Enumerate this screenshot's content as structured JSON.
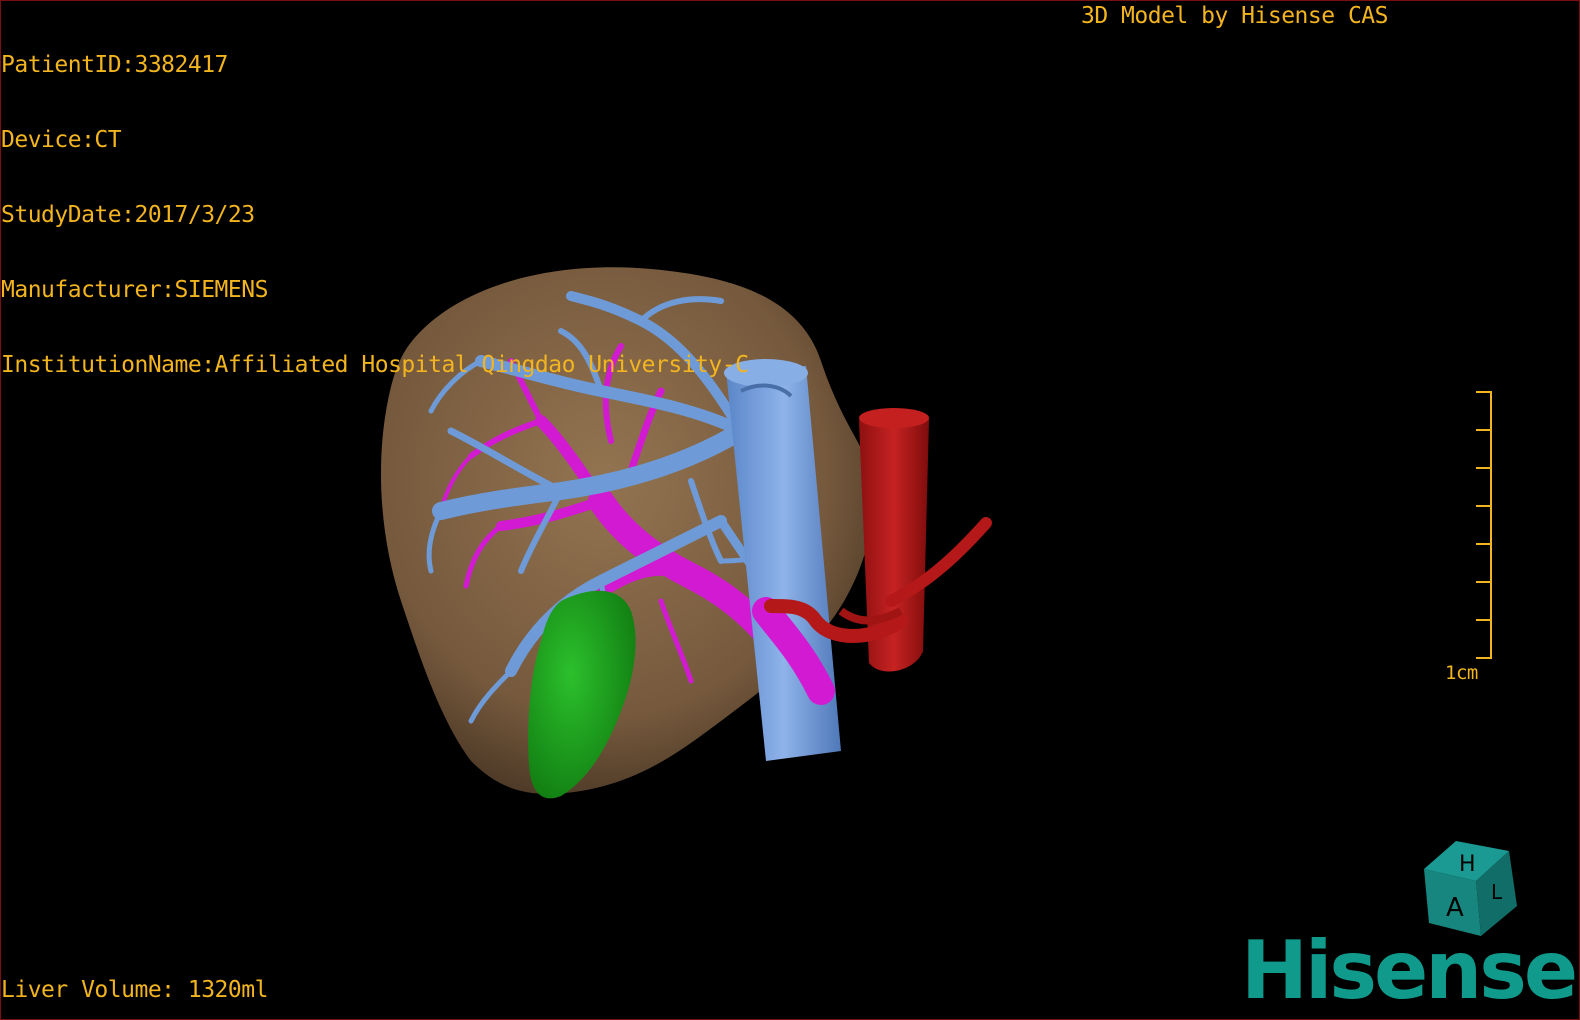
{
  "overlay": {
    "patient_id": "PatientID:3382417",
    "device": "Device:CT",
    "study_date": "StudyDate:2017/3/23",
    "manufacturer": "Manufacturer:SIEMENS",
    "institution": "InstitutionName:Affiliated Hospital Qingdao University-C",
    "model_credit": "3D Model by Hisense CAS",
    "liver_volume": "Liver Volume: 1320ml"
  },
  "scale_bar": {
    "label": "1cm"
  },
  "orientation_cube": {
    "face_top": "H",
    "face_front": "A",
    "face_side": "L"
  },
  "brand": {
    "logo_text": "Hisense"
  },
  "colors": {
    "overlay_text": "#f2b41f",
    "liver": "#8a6a47",
    "hepatic_vein": "#6e9bd8",
    "portal_vein": "#d21ad2",
    "gallbladder": "#19a319",
    "artery": "#b51818",
    "logo": "#0f9a8c"
  },
  "icons": [
    "orientation-cube-icon",
    "hisense-logo"
  ]
}
